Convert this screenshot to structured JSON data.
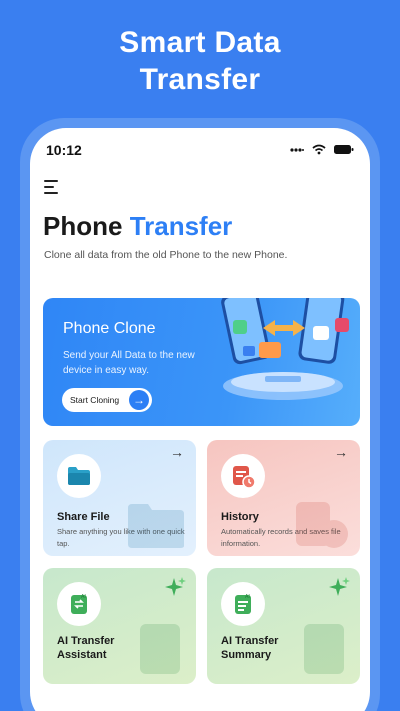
{
  "headline": {
    "line1": "Smart Data",
    "line2": "Transfer"
  },
  "status_bar": {
    "time": "10:12"
  },
  "page": {
    "title_word1": "Phone",
    "title_word2": "Transfer",
    "subtitle": "Clone all data from the old Phone to the new Phone."
  },
  "clone_card": {
    "title": "Phone Clone",
    "description": "Send your All Data to the new device in easy way.",
    "button_label": "Start Cloning"
  },
  "tiles": [
    {
      "title": "Share File",
      "description": "Share anything you like with one quick tap.",
      "icon": "folder-icon"
    },
    {
      "title": "History",
      "description": "Automatically records and saves file information.",
      "icon": "history-icon"
    },
    {
      "title": "AI Transfer",
      "title2": "Assistant",
      "icon": "ai-assistant-icon"
    },
    {
      "title": "AI Transfer",
      "title2": "Summary",
      "icon": "ai-summary-icon"
    }
  ],
  "colors": {
    "background": "#3a7ff0",
    "accent": "#2d7ff5",
    "share_tile": "#cfe6fb",
    "history_tile": "#f6c5c0",
    "ai_tile": "#c7e8cc"
  }
}
